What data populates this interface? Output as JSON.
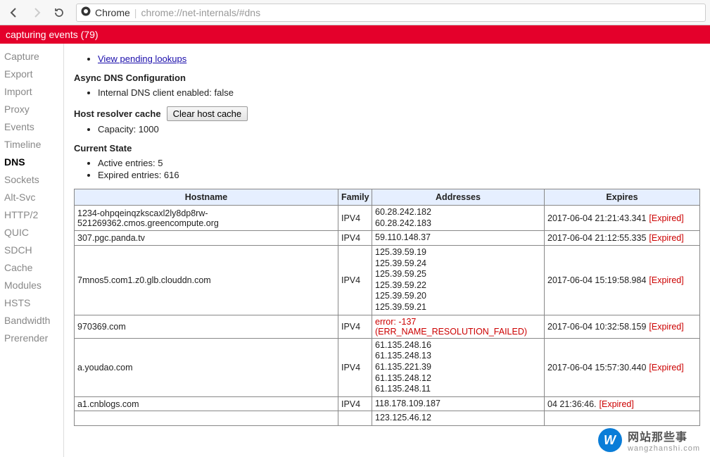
{
  "browser": {
    "product": "Chrome",
    "url_path": "chrome://net-internals/#dns"
  },
  "statusbar": {
    "text": "capturing events (79)"
  },
  "sidebar": {
    "items": [
      "Capture",
      "Export",
      "Import",
      "Proxy",
      "Events",
      "Timeline",
      "DNS",
      "Sockets",
      "Alt-Svc",
      "HTTP/2",
      "QUIC",
      "SDCH",
      "Cache",
      "Modules",
      "HSTS",
      "Bandwidth",
      "Prerender"
    ],
    "active": "DNS"
  },
  "content": {
    "pending_link": "View pending lookups",
    "async_head": "Async DNS Configuration",
    "async_line": "Internal DNS client enabled: false",
    "hrc_label": "Host resolver cache",
    "clear_btn": "Clear host cache",
    "capacity_line": "Capacity: 1000",
    "current_head": "Current State",
    "active_line": "Active entries: 5",
    "expired_line": "Expired entries: 616",
    "cols": {
      "hostname": "Hostname",
      "family": "Family",
      "addresses": "Addresses",
      "expires": "Expires"
    },
    "rows": [
      {
        "host": "1234-ohpqeinqzkscaxl2ly8dp8rw-521269362.cmos.greencompute.org",
        "family": "IPV4",
        "addresses": [
          "60.28.242.182",
          "60.28.242.183"
        ],
        "error": null,
        "expires": "2017-06-04 21:21:43.341",
        "expired": true
      },
      {
        "host": "307.pgc.panda.tv",
        "family": "IPV4",
        "addresses": [
          "59.110.148.37"
        ],
        "error": null,
        "expires": "2017-06-04 21:12:55.335",
        "expired": true
      },
      {
        "host": "7mnos5.com1.z0.glb.clouddn.com",
        "family": "IPV4",
        "addresses": [
          "125.39.59.19",
          "125.39.59.24",
          "125.39.59.25",
          "125.39.59.22",
          "125.39.59.20",
          "125.39.59.21"
        ],
        "error": null,
        "expires": "2017-06-04 15:19:58.984",
        "expired": true
      },
      {
        "host": "970369.com",
        "family": "IPV4",
        "addresses": [],
        "error": "error: -137 (ERR_NAME_RESOLUTION_FAILED)",
        "expires": "2017-06-04 10:32:58.159",
        "expired": true
      },
      {
        "host": "a.youdao.com",
        "family": "IPV4",
        "addresses": [
          "61.135.248.16",
          "61.135.248.13",
          "61.135.221.39",
          "61.135.248.12",
          "61.135.248.11"
        ],
        "error": null,
        "expires": "2017-06-04 15:57:30.440",
        "expired": true
      },
      {
        "host": "a1.cnblogs.com",
        "family": "IPV4",
        "addresses": [
          "118.178.109.187"
        ],
        "error": null,
        "expires": "04 21:36:46.",
        "expired": true
      },
      {
        "host": "",
        "family": "",
        "addresses": [
          "123.125.46.12"
        ],
        "error": null,
        "expires": "",
        "expired": false
      }
    ]
  },
  "watermark": {
    "initial": "W",
    "text1": "网站那些事",
    "text2": "wangzhanshi.com"
  }
}
